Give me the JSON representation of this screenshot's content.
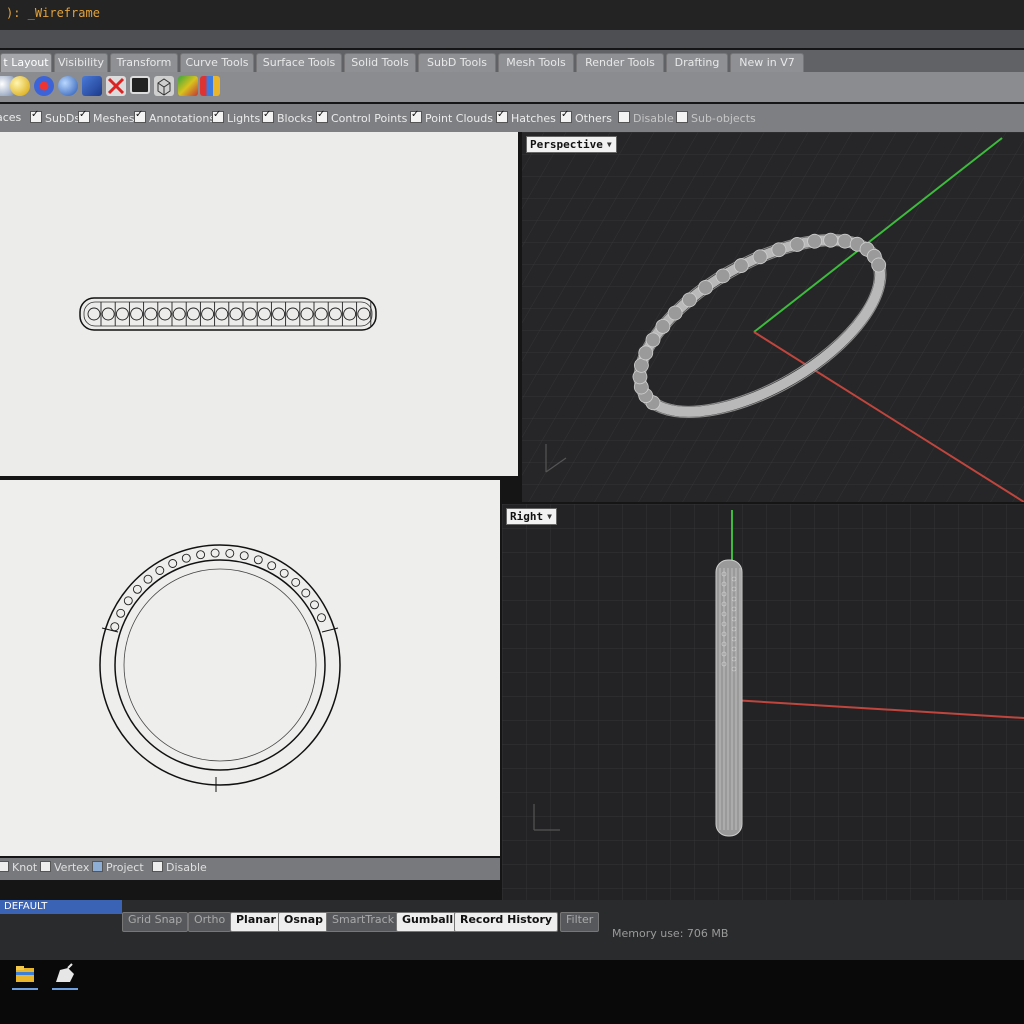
{
  "command": {
    "text": "): _Wireframe"
  },
  "tabs": [
    {
      "label": "t Layout"
    },
    {
      "label": "Visibility"
    },
    {
      "label": "Transform"
    },
    {
      "label": "Curve Tools"
    },
    {
      "label": "Surface Tools"
    },
    {
      "label": "Solid Tools"
    },
    {
      "label": "SubD Tools"
    },
    {
      "label": "Mesh Tools"
    },
    {
      "label": "Render Tools"
    },
    {
      "label": "Drafting"
    },
    {
      "label": "New in V7"
    }
  ],
  "filters": [
    {
      "label": "aces",
      "checked": null
    },
    {
      "label": "SubDs",
      "checked": true
    },
    {
      "label": "Meshes",
      "checked": true
    },
    {
      "label": "Annotations",
      "checked": true
    },
    {
      "label": "Lights",
      "checked": true
    },
    {
      "label": "Blocks",
      "checked": true
    },
    {
      "label": "Control Points",
      "checked": true
    },
    {
      "label": "Point Clouds",
      "checked": true
    },
    {
      "label": "Hatches",
      "checked": true
    },
    {
      "label": "Others",
      "checked": true
    },
    {
      "label": "Disable",
      "checked": false
    },
    {
      "label": "Sub-objects",
      "checked": false
    }
  ],
  "viewports": {
    "perspective": {
      "label": "Perspective"
    },
    "right": {
      "label": "Right"
    }
  },
  "osnap": [
    {
      "label": "Knot",
      "checked": false
    },
    {
      "label": "Vertex",
      "checked": false
    },
    {
      "label": "Project",
      "checked": true
    },
    {
      "label": "Disable",
      "checked": false
    }
  ],
  "status": {
    "layer": "DEFAULT",
    "buttons": [
      {
        "label": "Grid Snap",
        "active": false
      },
      {
        "label": "Ortho",
        "active": false
      },
      {
        "label": "Planar",
        "active": true
      },
      {
        "label": "Osnap",
        "active": true
      },
      {
        "label": "SmartTrack",
        "active": false
      },
      {
        "label": "Gumball",
        "active": true
      },
      {
        "label": "Record History",
        "active": true
      },
      {
        "label": "Filter",
        "active": false
      }
    ],
    "memory": "Memory use: 706 MB"
  },
  "colors": {
    "x_axis": "#c0463d",
    "y_axis": "#3dbb3d",
    "dark_viewport_bg": "#262628",
    "light_viewport_bg": "#ececea"
  }
}
